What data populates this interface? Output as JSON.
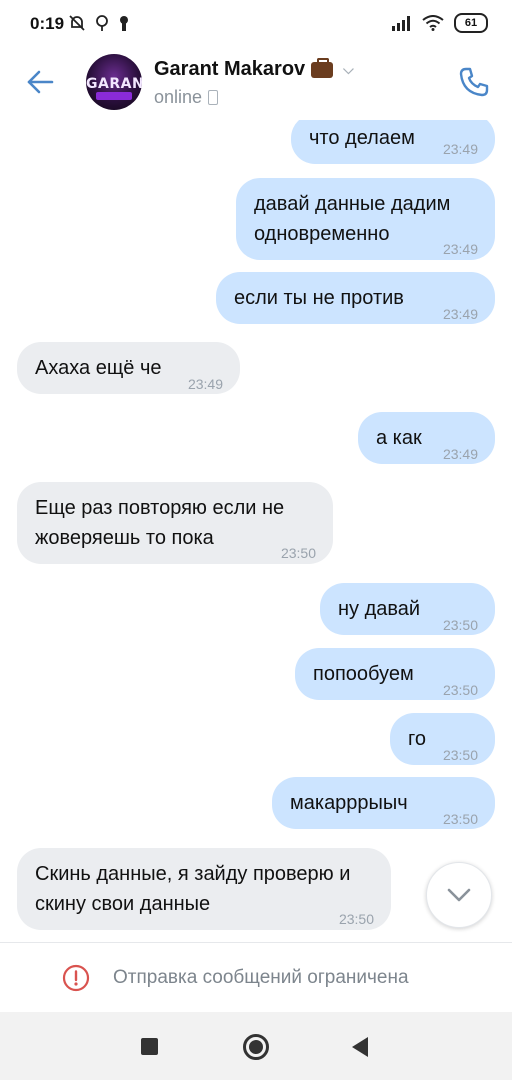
{
  "status_bar": {
    "time": "0:19",
    "battery": "61"
  },
  "header": {
    "contact_name": "Garant Makarov",
    "status": "online",
    "avatar_text": "GARANT"
  },
  "messages": [
    {
      "text": "что делаем",
      "time": "23:49",
      "direction": "out"
    },
    {
      "text": "давай данные дадим одновременно",
      "time": "23:49",
      "direction": "out"
    },
    {
      "text": "если ты не против",
      "time": "23:49",
      "direction": "out"
    },
    {
      "text": "Ахаха ещё че",
      "time": "23:49",
      "direction": "in"
    },
    {
      "text": "а как",
      "time": "23:49",
      "direction": "out"
    },
    {
      "text": "Еще раз повторяю если не жоверяешь то пока",
      "time": "23:50",
      "direction": "in"
    },
    {
      "text": "ну давай",
      "time": "23:50",
      "direction": "out"
    },
    {
      "text": "попообуем",
      "time": "23:50",
      "direction": "out"
    },
    {
      "text": "го",
      "time": "23:50",
      "direction": "out"
    },
    {
      "text": "макарррыыч",
      "time": "23:50",
      "direction": "out"
    },
    {
      "text": "Скинь данные, я зайду проверю и скину свои данные",
      "time": "23:50",
      "direction": "in"
    }
  ],
  "restriction": {
    "text": "Отправка сообщений ограничена"
  },
  "colors": {
    "accent": "#4a86c8",
    "bubble_out": "#cce4ff",
    "bubble_in": "#ebedf0",
    "warning": "#d9534f"
  },
  "icons": {
    "back": "arrow-left-icon",
    "call": "phone-icon",
    "scroll": "chevron-down-icon",
    "warning": "exclamation-circle-icon"
  }
}
